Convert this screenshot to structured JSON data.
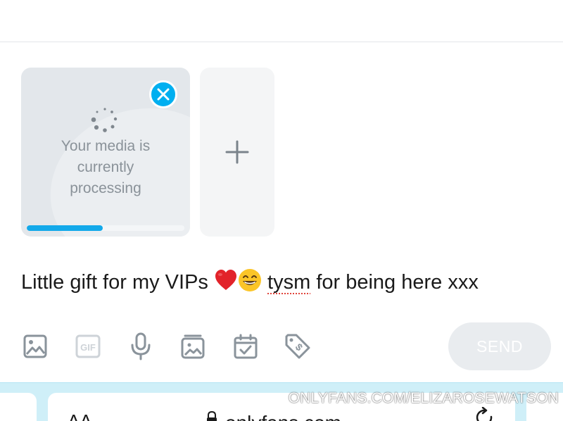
{
  "media": {
    "status_line1": "Your media is",
    "status_line2": "currently",
    "status_line3": "processing",
    "progress_percent": 48
  },
  "post": {
    "text_before": "Little gift for my VIPs ",
    "misspelled_word": "tysm",
    "text_after": " for being here xxx"
  },
  "toolbar": {
    "icons": [
      "image-icon",
      "gif-icon",
      "microphone-icon",
      "vault-icon",
      "schedule-icon",
      "price-tag-icon"
    ],
    "gif_label": "GIF",
    "send_label": "SEND"
  },
  "browser": {
    "aa_label": "AA",
    "url": "onlyfans.com"
  },
  "watermark": "ONLYFANS.COM/ELIZAROSEWATSON",
  "colors": {
    "accent": "#00aff0",
    "progress": "#13a9ea",
    "icon_gray": "#8a939b",
    "send_disabled_bg": "#e9ecef",
    "browser_bar": "#cfeff8"
  }
}
